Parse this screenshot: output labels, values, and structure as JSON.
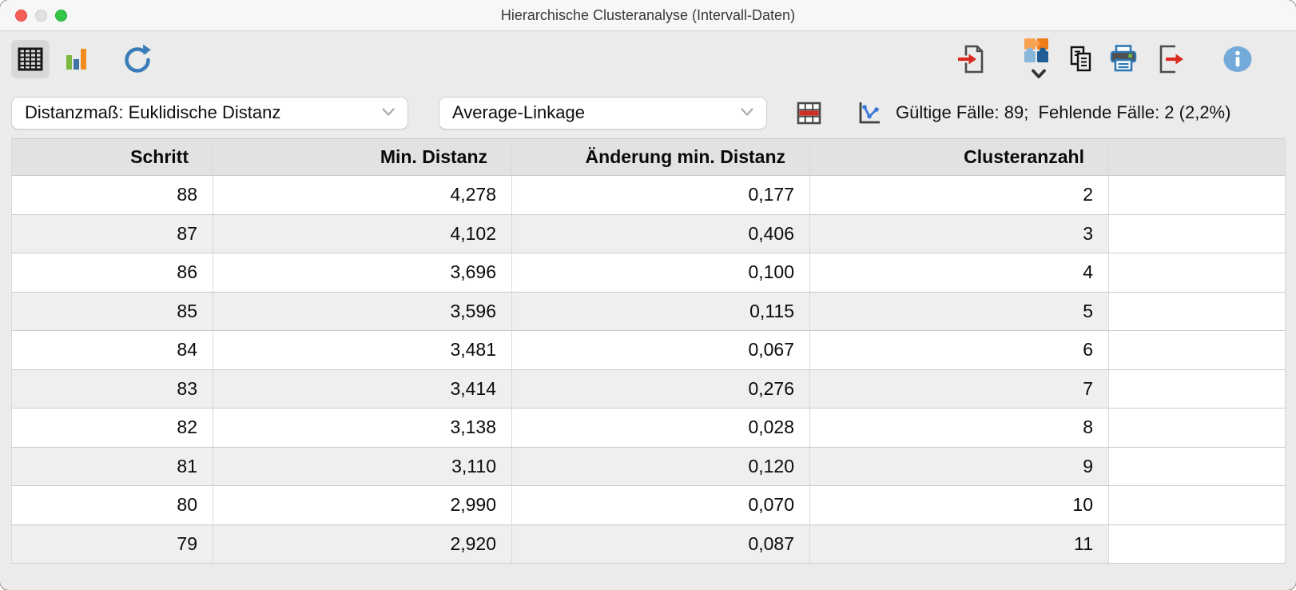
{
  "window": {
    "title": "Hierarchische Clusteranalyse (Intervall-Daten)"
  },
  "titlebar": {
    "traffic_lights": [
      "close",
      "minimize-disabled",
      "zoom"
    ]
  },
  "toolbar": {
    "left_icons": [
      "table-view-icon",
      "chart-view-icon",
      "refresh-icon"
    ],
    "right_icons": [
      "import-document-icon",
      "puzzle-plugins-icon",
      "chevron-down-icon",
      "copy-icon",
      "print-icon",
      "export-document-icon",
      "info-icon"
    ]
  },
  "controls": {
    "distance_value": "Distanzmaß: Euklidische Distanz",
    "linkage_value": "Average-Linkage",
    "inline_icons": [
      "highlight-row-table-icon",
      "line-chart-icon"
    ],
    "stats_text": "Gültige Fälle: 89;  Fehlende Fälle: 2 (2,2%)"
  },
  "table": {
    "columns": [
      "Schritt",
      "Min. Distanz",
      "Änderung min. Distanz",
      "Clusteranzahl"
    ],
    "rows": [
      {
        "schritt": "88",
        "min_distanz": "4,278",
        "aenderung": "0,177",
        "clusteranzahl": "2"
      },
      {
        "schritt": "87",
        "min_distanz": "4,102",
        "aenderung": "0,406",
        "clusteranzahl": "3"
      },
      {
        "schritt": "86",
        "min_distanz": "3,696",
        "aenderung": "0,100",
        "clusteranzahl": "4"
      },
      {
        "schritt": "85",
        "min_distanz": "3,596",
        "aenderung": "0,115",
        "clusteranzahl": "5"
      },
      {
        "schritt": "84",
        "min_distanz": "3,481",
        "aenderung": "0,067",
        "clusteranzahl": "6"
      },
      {
        "schritt": "83",
        "min_distanz": "3,414",
        "aenderung": "0,276",
        "clusteranzahl": "7"
      },
      {
        "schritt": "82",
        "min_distanz": "3,138",
        "aenderung": "0,028",
        "clusteranzahl": "8"
      },
      {
        "schritt": "81",
        "min_distanz": "3,110",
        "aenderung": "0,120",
        "clusteranzahl": "9"
      },
      {
        "schritt": "80",
        "min_distanz": "2,990",
        "aenderung": "0,070",
        "clusteranzahl": "10"
      },
      {
        "schritt": "79",
        "min_distanz": "2,920",
        "aenderung": "0,087",
        "clusteranzahl": "11"
      }
    ]
  },
  "colors": {
    "refresh_blue": "#3a7cb8",
    "info_blue": "#74aad9",
    "arrow_red": "#d92b21",
    "highlight_row_red": "#cf2e24",
    "bar_green": "#7db93f",
    "bar_blue": "#3f74a4",
    "bar_orange": "#f18c1f",
    "printer_blue": "#2e79b5",
    "puzzle_orange_light": "#f8a351",
    "puzzle_orange_dark": "#ee7c17",
    "puzzle_blue_light": "#8ab8da",
    "puzzle_blue_dark": "#1e5e93",
    "traffic_red": "#f55f58",
    "traffic_gray": "#e2e1e1",
    "traffic_green": "#33c748",
    "header_bg": "#e2e2e2",
    "alt_row_bg": "#efefef"
  }
}
